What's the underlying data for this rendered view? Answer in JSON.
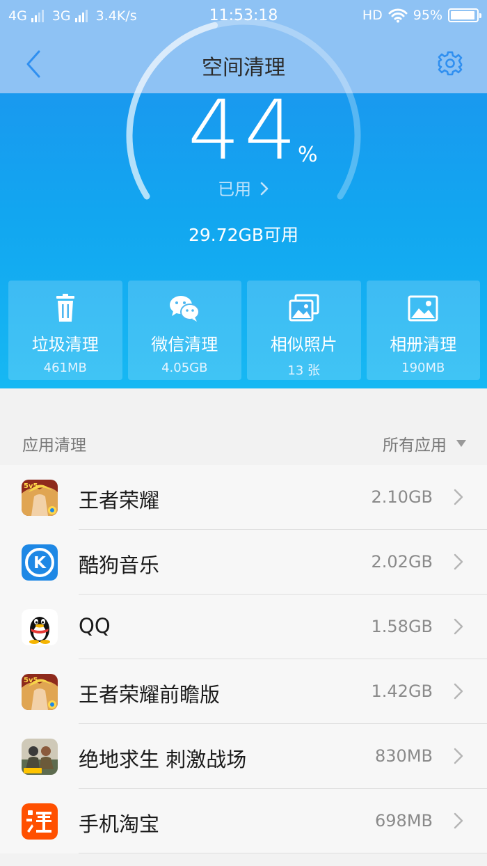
{
  "status_bar": {
    "network1": "4G",
    "network2": "3G",
    "speed": "3.4K/s",
    "time": "11:53:18",
    "hd": "HD",
    "battery": "95%",
    "battery_level": 0.95
  },
  "header": {
    "title": "空间清理"
  },
  "storage": {
    "percent": "44",
    "percent_sign": "%",
    "used_label": "已用",
    "used_fraction": 0.44,
    "available": "29.72GB可用"
  },
  "tiles": [
    {
      "label": "垃圾清理",
      "value": "461MB",
      "icon": "trash-icon"
    },
    {
      "label": "微信清理",
      "value": "4.05GB",
      "icon": "wechat-icon"
    },
    {
      "label": "相似照片",
      "value": "13 张",
      "icon": "similar-photos-icon"
    },
    {
      "label": "相册清理",
      "value": "190MB",
      "icon": "album-icon"
    }
  ],
  "app_section": {
    "title": "应用清理",
    "filter": "所有应用"
  },
  "apps": [
    {
      "name": "王者荣耀",
      "size": "2.10GB",
      "icon": "honor-of-kings-icon",
      "color": "#c0392b"
    },
    {
      "name": "酷狗音乐",
      "size": "2.02GB",
      "icon": "kugou-icon",
      "color": "#1e88e5"
    },
    {
      "name": "QQ",
      "size": "1.58GB",
      "icon": "qq-icon",
      "color": "#ffffff"
    },
    {
      "name": "王者荣耀前瞻版",
      "size": "1.42GB",
      "icon": "honor-of-kings-preview-icon",
      "color": "#c0392b"
    },
    {
      "name": "绝地求生 刺激战场",
      "size": "830MB",
      "icon": "pubg-icon",
      "color": "#5d6b4f"
    },
    {
      "name": "手机淘宝",
      "size": "698MB",
      "icon": "taobao-icon",
      "color": "#ff5000"
    }
  ]
}
